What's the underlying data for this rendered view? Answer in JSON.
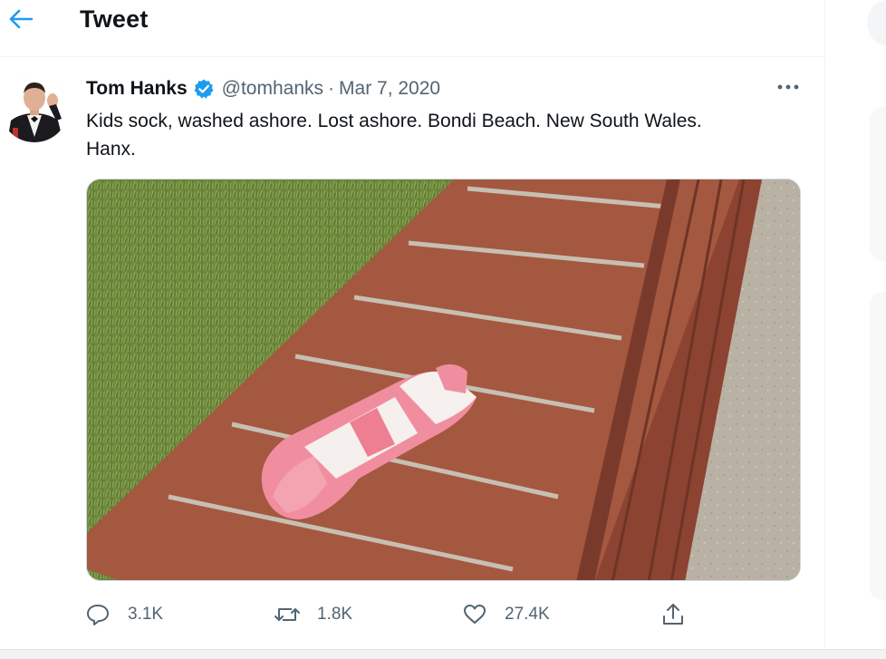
{
  "header": {
    "title": "Tweet",
    "back_icon": "arrow-left-icon"
  },
  "tweet": {
    "author_name": "Tom Hanks",
    "verified": true,
    "handle": "@tomhanks",
    "separator": "·",
    "date": "Mar 7, 2020",
    "text_line1": "Kids sock, washed ashore. Lost ashore. Bondi Beach. New South Wales.",
    "text_line2": "Hanx.",
    "more_icon": "more-horizontal-icon"
  },
  "actions": {
    "reply": {
      "icon": "reply-icon",
      "count": "3.1K"
    },
    "retweet": {
      "icon": "retweet-icon",
      "count": "1.8K"
    },
    "like": {
      "icon": "heart-icon",
      "count": "27.4K"
    },
    "share": {
      "icon": "share-icon"
    }
  },
  "colors": {
    "accent": "#1d9bf0",
    "text": "#0f1419",
    "secondary_text": "#536471",
    "border": "#eff3f4"
  }
}
